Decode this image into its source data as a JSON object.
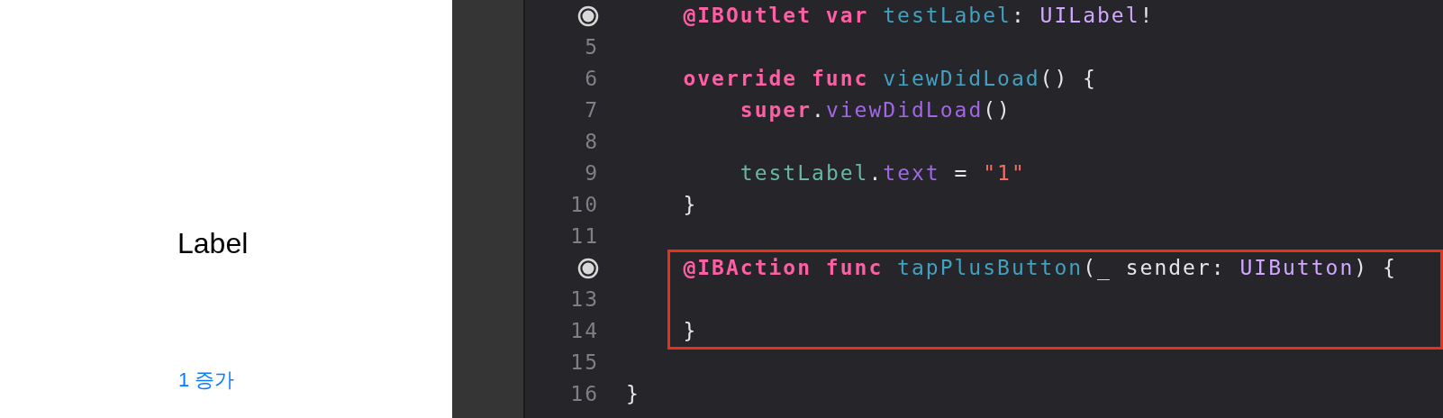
{
  "preview": {
    "label": "Label",
    "button": "1 증가"
  },
  "editor": {
    "lines": [
      {
        "children": [
          {
            "connected": true,
            "highlighted": false,
            "tokens": [
              {
                "text": "@IBOutlet var",
                "kind": "keyword"
              },
              {
                "text": " testLabel",
                "kind": "decl"
              },
              {
                "text": ": ",
                "kind": "plain"
              },
              {
                "text": "UILabel",
                "kind": "type"
              },
              {
                "text": "!",
                "kind": "plain"
              }
            ]
          },
          {
            "number": "5",
            "connected": false,
            "highlighted": false
          },
          {
            "number": "6",
            "connected": false,
            "highlighted": false,
            "tokens": [
              {
                "text": "override func",
                "kind": "keyword"
              },
              {
                "text": " viewDidLoad",
                "kind": "decl"
              },
              {
                "text": "() {",
                "kind": "plain"
              }
            ],
            "children": [
              {
                "number": "7",
                "connected": false,
                "highlighted": false,
                "tokens": [
                  {
                    "text": "super",
                    "kind": "keyword"
                  },
                  {
                    "text": ".",
                    "kind": "plain"
                  },
                  {
                    "text": "viewDidLoad",
                    "kind": "call"
                  },
                  {
                    "text": "()",
                    "kind": "plain"
                  }
                ]
              },
              {
                "number": "8",
                "connected": false,
                "highlighted": false
              },
              {
                "number": "9",
                "connected": false,
                "highlighted": false,
                "tokens": [
                  {
                    "text": "testLabel",
                    "kind": "ref"
                  },
                  {
                    "text": ".",
                    "kind": "plain"
                  },
                  {
                    "text": "text",
                    "kind": "call"
                  },
                  {
                    "text": " = ",
                    "kind": "plain"
                  },
                  {
                    "text": "\"1\"",
                    "kind": "string"
                  }
                ]
              }
            ]
          },
          {
            "number": "10",
            "connected": false,
            "highlighted": false,
            "tokens": [
              {
                "text": "}",
                "kind": "plain"
              }
            ]
          },
          {
            "number": "11",
            "connected": false,
            "highlighted": false
          },
          {
            "connected": true,
            "highlighted": true,
            "tokens": [
              {
                "text": "@IBAction func",
                "kind": "keyword"
              },
              {
                "text": " tapPlusButton",
                "kind": "decl"
              },
              {
                "text": "(_ sender: ",
                "kind": "plain"
              },
              {
                "text": "UIButton",
                "kind": "type"
              },
              {
                "text": ") {",
                "kind": "plain"
              }
            ],
            "children": [
              {
                "number": "13",
                "connected": false,
                "highlighted": true
              }
            ]
          },
          {
            "number": "14",
            "connected": false,
            "highlighted": true,
            "tokens": [
              {
                "text": "}",
                "kind": "plain"
              }
            ]
          },
          {
            "number": "15",
            "connected": false,
            "highlighted": false
          }
        ]
      },
      {
        "number": "16",
        "connected": false,
        "highlighted": false,
        "tokens": [
          {
            "text": "}",
            "kind": "plain"
          }
        ]
      }
    ]
  }
}
